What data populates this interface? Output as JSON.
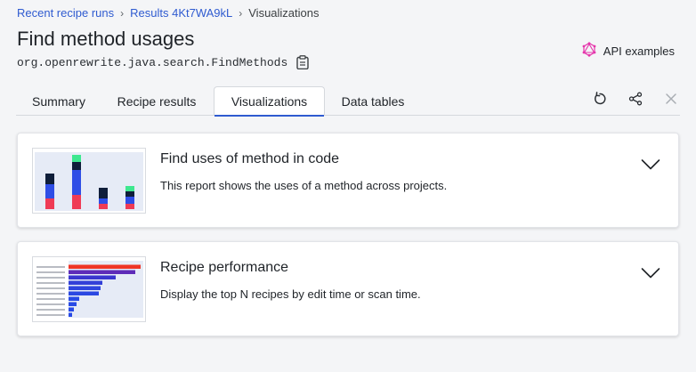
{
  "breadcrumb": {
    "items": [
      "Recent recipe runs",
      "Results 4Kt7WA9kL"
    ],
    "separator": "›",
    "current": "Visualizations"
  },
  "page": {
    "title": "Find method usages",
    "recipe_id": "org.openrewrite.java.search.FindMethods"
  },
  "api_examples": {
    "label": "API examples",
    "icon": "graphql-icon",
    "icon_color": "#e535ab"
  },
  "tabs": [
    {
      "label": "Summary",
      "active": false
    },
    {
      "label": "Recipe results",
      "active": false
    },
    {
      "label": "Visualizations",
      "active": true
    },
    {
      "label": "Data tables",
      "active": false
    }
  ],
  "tab_tools": [
    "rerun-icon",
    "share-icon",
    "close-icon"
  ],
  "accent_color": "#2f5bd0",
  "cards": [
    {
      "title": "Find uses of method in code",
      "description": "This report shows the uses of a method across projects.",
      "thumbnail": "stacked-bar-chart-thumbnail"
    },
    {
      "title": "Recipe performance",
      "description": "Display the top N recipes by edit time or scan time.",
      "thumbnail": "horizontal-bar-chart-thumbnail"
    }
  ]
}
